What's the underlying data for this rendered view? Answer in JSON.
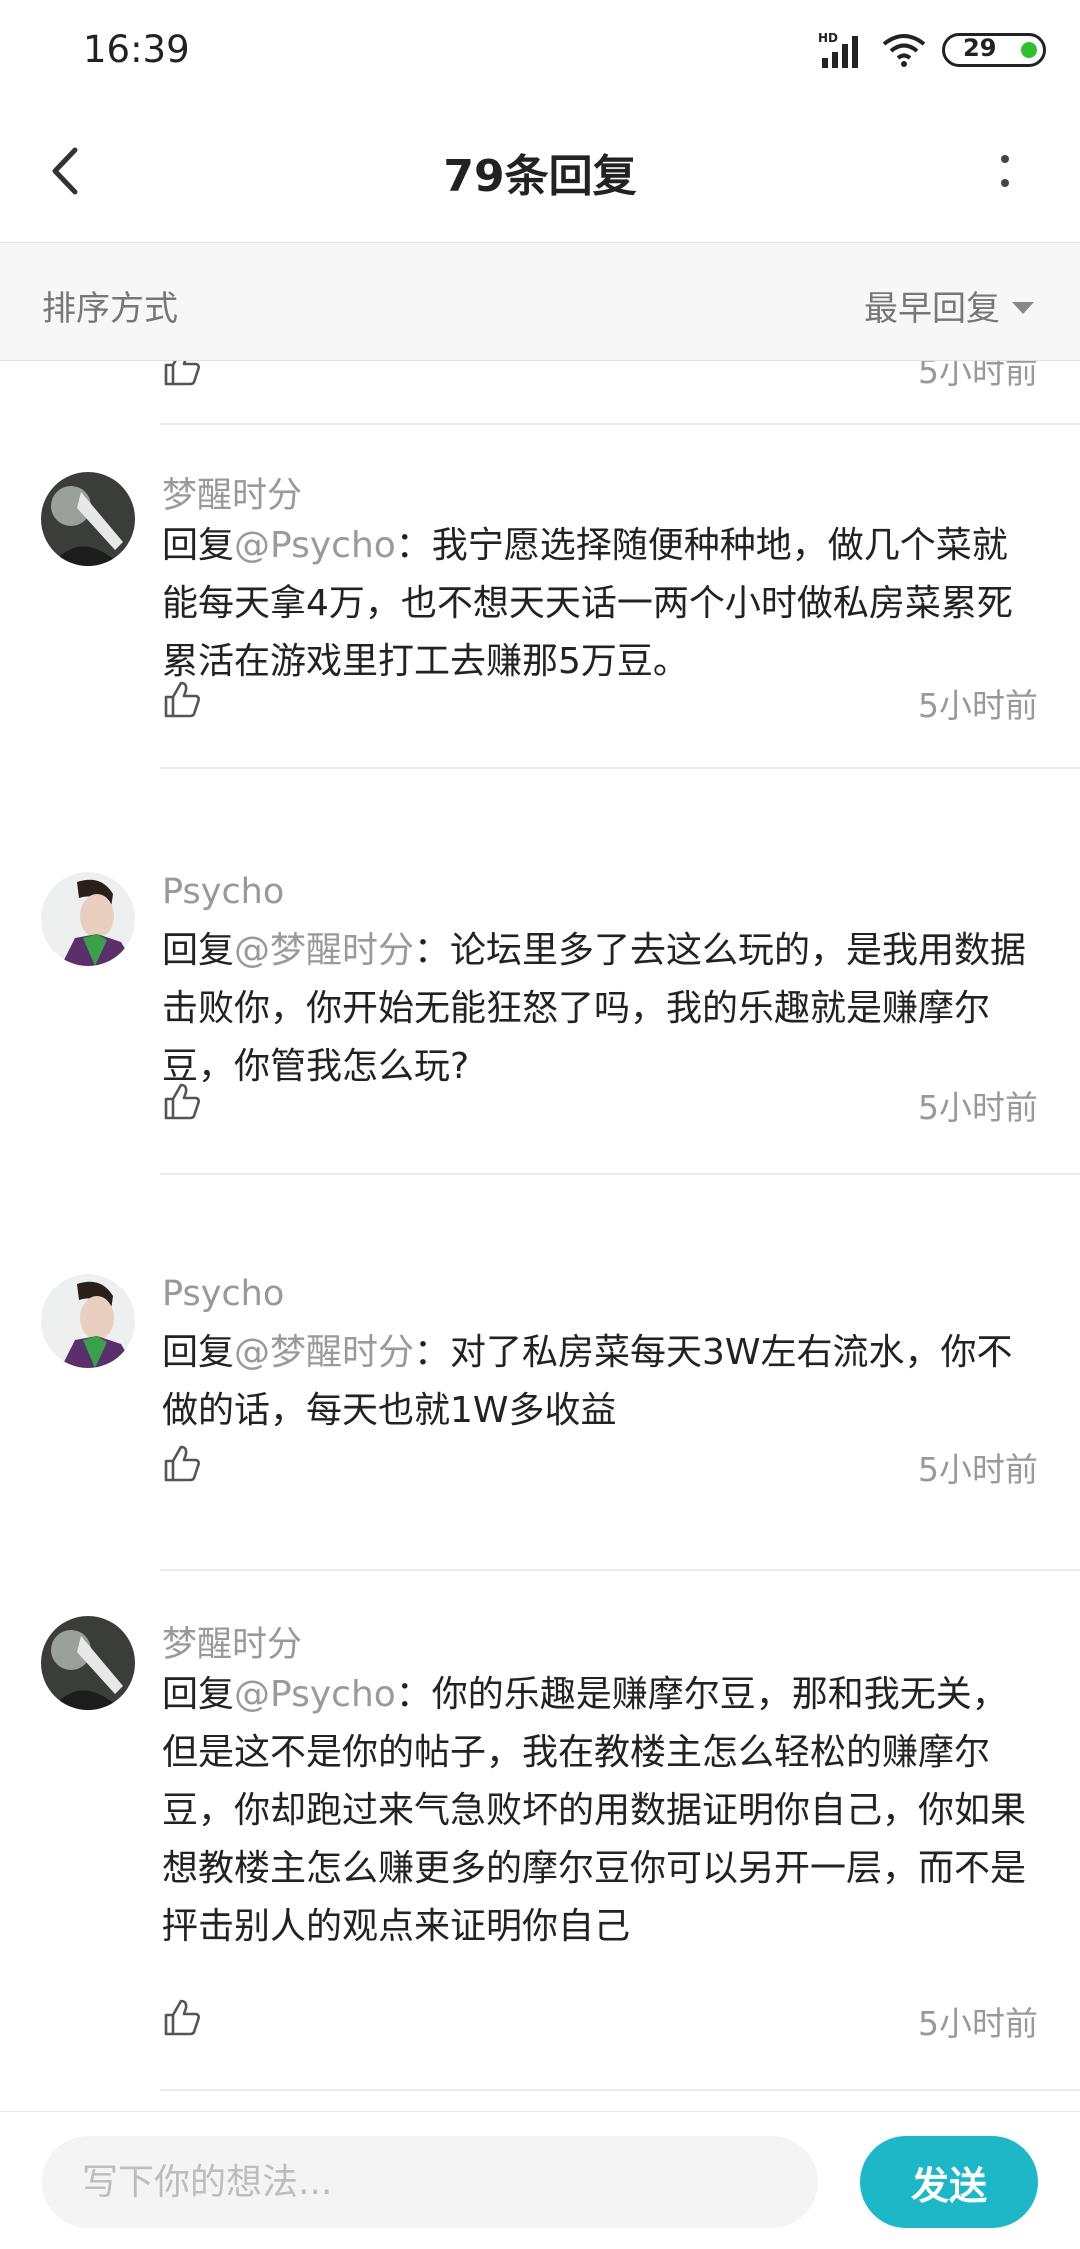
{
  "status_bar": {
    "time": "16:39",
    "battery": "29",
    "network": "HD"
  },
  "header": {
    "title": "79条回复"
  },
  "sort": {
    "label": "排序方式",
    "selected": "最早回复"
  },
  "prev_item": {
    "time": "5小时前"
  },
  "replies": [
    {
      "user": "梦醒时分",
      "reply_prefix": "回复",
      "mention": "@Psycho",
      "text": "：我宁愿选择随便种种地，做几个菜就能每天拿4万，也不想天天话一两个小时做私房菜累死累活在游戏里打工去赚那5万豆。",
      "time": "5小时前"
    },
    {
      "user": "Psycho",
      "reply_prefix": "回复",
      "mention": "@梦醒时分",
      "text": "：论坛里多了去这么玩的，是我用数据击败你，你开始无能狂怒了吗，我的乐趣就是赚摩尔豆，你管我怎么玩?",
      "time": "5小时前"
    },
    {
      "user": "Psycho",
      "reply_prefix": "回复",
      "mention": "@梦醒时分",
      "text": "：对了私房菜每天3W左右流水，你不做的话，每天也就1W多收益",
      "time": "5小时前"
    },
    {
      "user": "梦醒时分",
      "reply_prefix": "回复",
      "mention": "@Psycho",
      "text": "：你的乐趣是赚摩尔豆，那和我无关，但是这不是你的帖子，我在教楼主怎么轻松的赚摩尔豆，你却跑过来气急败坏的用数据证明你自己，你如果想教楼主怎么赚更多的摩尔豆你可以另开一层，而不是抨击别人的观点来证明你自己",
      "time": "5小时前"
    }
  ],
  "composer": {
    "placeholder": "写下你的想法...",
    "send_label": "发送"
  },
  "colors": {
    "accent": "#1eb7c8",
    "mention": "#9a9a9a"
  }
}
